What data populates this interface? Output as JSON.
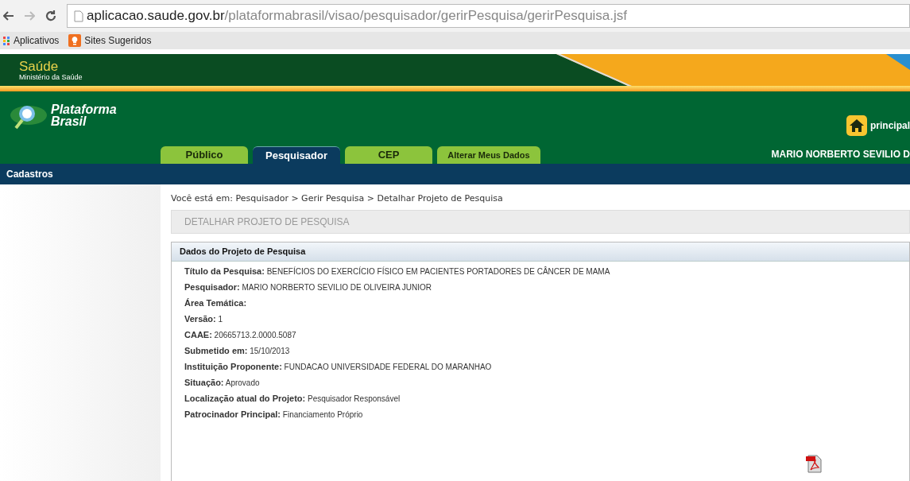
{
  "browser": {
    "url_host": "aplicacao.saude.gov.br",
    "url_path": "/plataformabrasil/visao/pesquisador/gerirPesquisa/gerirPesquisa.jsf",
    "bookmarks": [
      "Aplicativos",
      "Sites Sugeridos"
    ]
  },
  "banner": {
    "title": "Saúde",
    "subtitle": "Ministério da Saúde"
  },
  "header": {
    "logo_line1": "Plataforma",
    "logo_line2": "Brasil",
    "home_link": "principal",
    "user": "MARIO NORBERTO SEVILIO D"
  },
  "tabs": [
    {
      "label": "Público",
      "selected": false
    },
    {
      "label": "Pesquisador",
      "selected": true
    },
    {
      "label": "CEP",
      "selected": false
    },
    {
      "label": "Alterar Meus Dados",
      "selected": false
    }
  ],
  "menu": [
    "Cadastros"
  ],
  "breadcrumb": "Você está em: Pesquisador > Gerir Pesquisa > Detalhar Projeto de Pesquisa",
  "page_title": "DETALHAR PROJETO DE PESQUISA",
  "panel": {
    "title": "Dados do Projeto de Pesquisa",
    "fields": [
      {
        "label": "Título da Pesquisa:",
        "value": "BENEFÍCIOS DO EXERCÍCIO FÍSICO EM PACIENTES PORTADORES DE CÂNCER DE MAMA"
      },
      {
        "label": "Pesquisador:",
        "value": "MARIO NORBERTO SEVILIO DE OLIVEIRA JUNIOR"
      },
      {
        "label": "Área Temática:"
      },
      {
        "label": "Versão:",
        "value": "1"
      },
      {
        "label": "CAAE:",
        "value": "20665713.2.0000.5087"
      },
      {
        "label": "Submetido em:",
        "value": "15/10/2013"
      },
      {
        "label": "Instituição Proponente:",
        "value": "FUNDACAO UNIVERSIDADE FEDERAL DO MARANHAO"
      },
      {
        "label": "Situação:",
        "value": "Aprovado"
      },
      {
        "label": "Localização atual do Projeto:",
        "value": "Pesquisador Responsável"
      },
      {
        "label": "Patrocinador Principal:",
        "value": "Financiamento Próprio"
      }
    ]
  }
}
